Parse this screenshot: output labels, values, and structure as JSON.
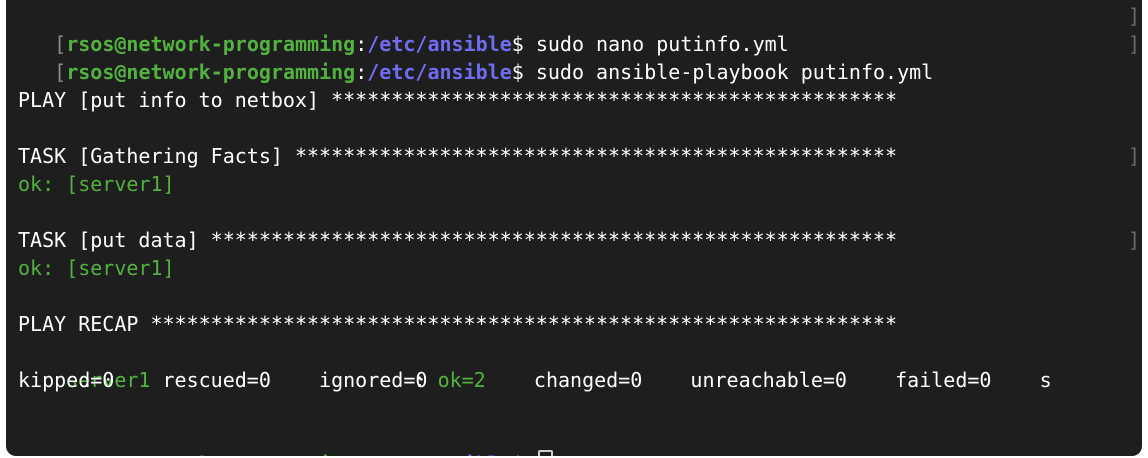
{
  "prompt": {
    "user_host": "rsos@network-programming",
    "path": "/etc/ansible",
    "symbol": "$"
  },
  "commands": [
    "sudo nano putinfo.yml",
    "sudo ansible-playbook putinfo.yml"
  ],
  "output": {
    "play_line": "PLAY [put info to netbox] ***********************************************",
    "task1_line": "TASK [Gathering Facts] **************************************************",
    "task1_result": "ok: [server1]",
    "task2_line": "TASK [put data] *********************************************************",
    "task2_result": "ok: [server1]",
    "recap_line": "PLAY RECAP **************************************************************",
    "recap_host": "server1",
    "recap_sep": ": ",
    "recap_ok": "ok=2",
    "recap_rest1": "    changed=0    unreachable=0    failed=0    s",
    "recap_rest2": "kipped=0    rescued=0    ignored=0"
  },
  "colors": {
    "green": "#53b23f",
    "blue": "#6f6cf2",
    "background": "#1e1e1e"
  }
}
